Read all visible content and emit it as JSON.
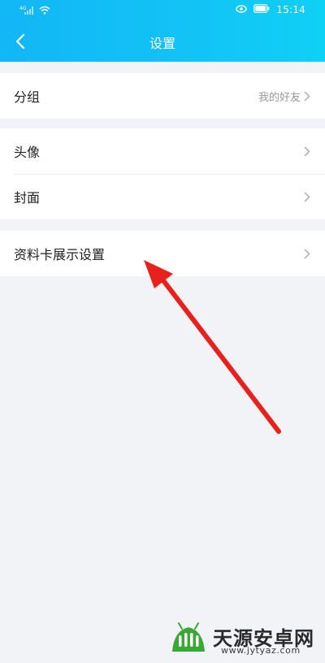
{
  "status_bar": {
    "time": "15:14",
    "icons": [
      "signal-icon",
      "wifi-icon",
      "eye-icon",
      "battery-icon"
    ]
  },
  "nav": {
    "title": "设置",
    "back_icon": "chevron-left-icon"
  },
  "groups": [
    {
      "items": [
        {
          "label": "分组",
          "value": "我的好友"
        }
      ]
    },
    {
      "items": [
        {
          "label": "头像"
        },
        {
          "label": "封面"
        }
      ]
    },
    {
      "items": [
        {
          "label": "资料卡展示设置"
        }
      ]
    }
  ],
  "annotation": {
    "color": "#e8211d",
    "icon": "red-arrow"
  },
  "watermark": {
    "title": "天源安卓网",
    "url": "www.jytyaz.com",
    "logo_color": "#3aa835"
  },
  "colors": {
    "header_start": "#12b7f5",
    "header_end": "#0fd0f5",
    "background": "#f2f3f7"
  }
}
